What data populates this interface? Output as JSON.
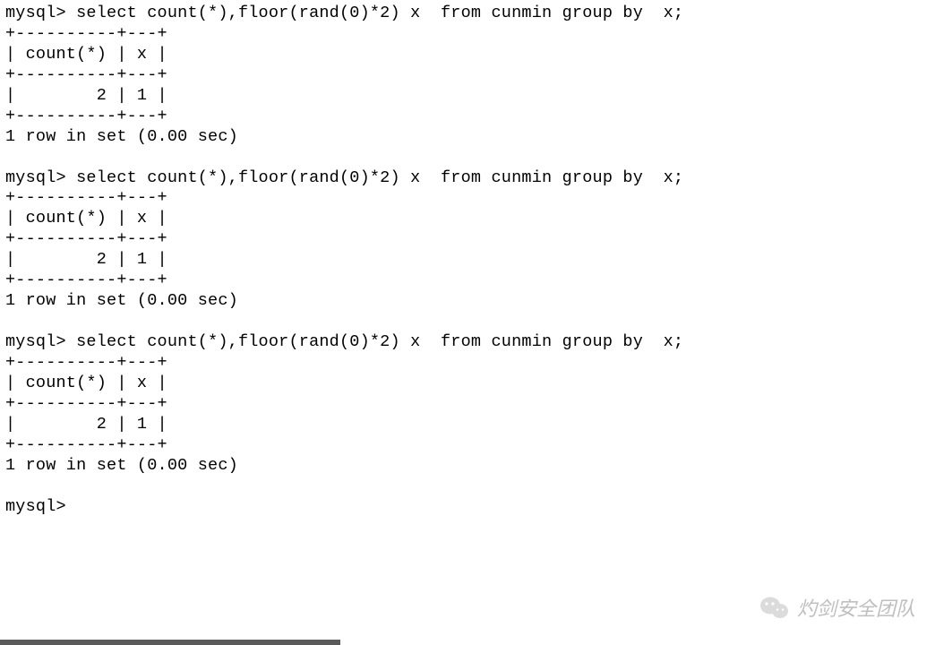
{
  "terminal": {
    "prompt": "mysql>",
    "blocks": [
      {
        "command": "select count(*),floor(rand(0)*2) x  from cunmin group by  x;",
        "table": {
          "border": "+----------+---+",
          "header": "| count(*) | x |",
          "row": "|        2 | 1 |"
        },
        "status": "1 row in set (0.00 sec)"
      },
      {
        "command": "select count(*),floor(rand(0)*2) x  from cunmin group by  x;",
        "table": {
          "border": "+----------+---+",
          "header": "| count(*) | x |",
          "row": "|        2 | 1 |"
        },
        "status": "1 row in set (0.00 sec)"
      },
      {
        "command": "select count(*),floor(rand(0)*2) x  from cunmin group by  x;",
        "table": {
          "border": "+----------+---+",
          "header": "| count(*) | x |",
          "row": "|        2 | 1 |"
        },
        "status": "1 row in set (0.00 sec)"
      }
    ],
    "final_prompt": "mysql>"
  },
  "watermark": {
    "text": "灼剑安全团队"
  }
}
